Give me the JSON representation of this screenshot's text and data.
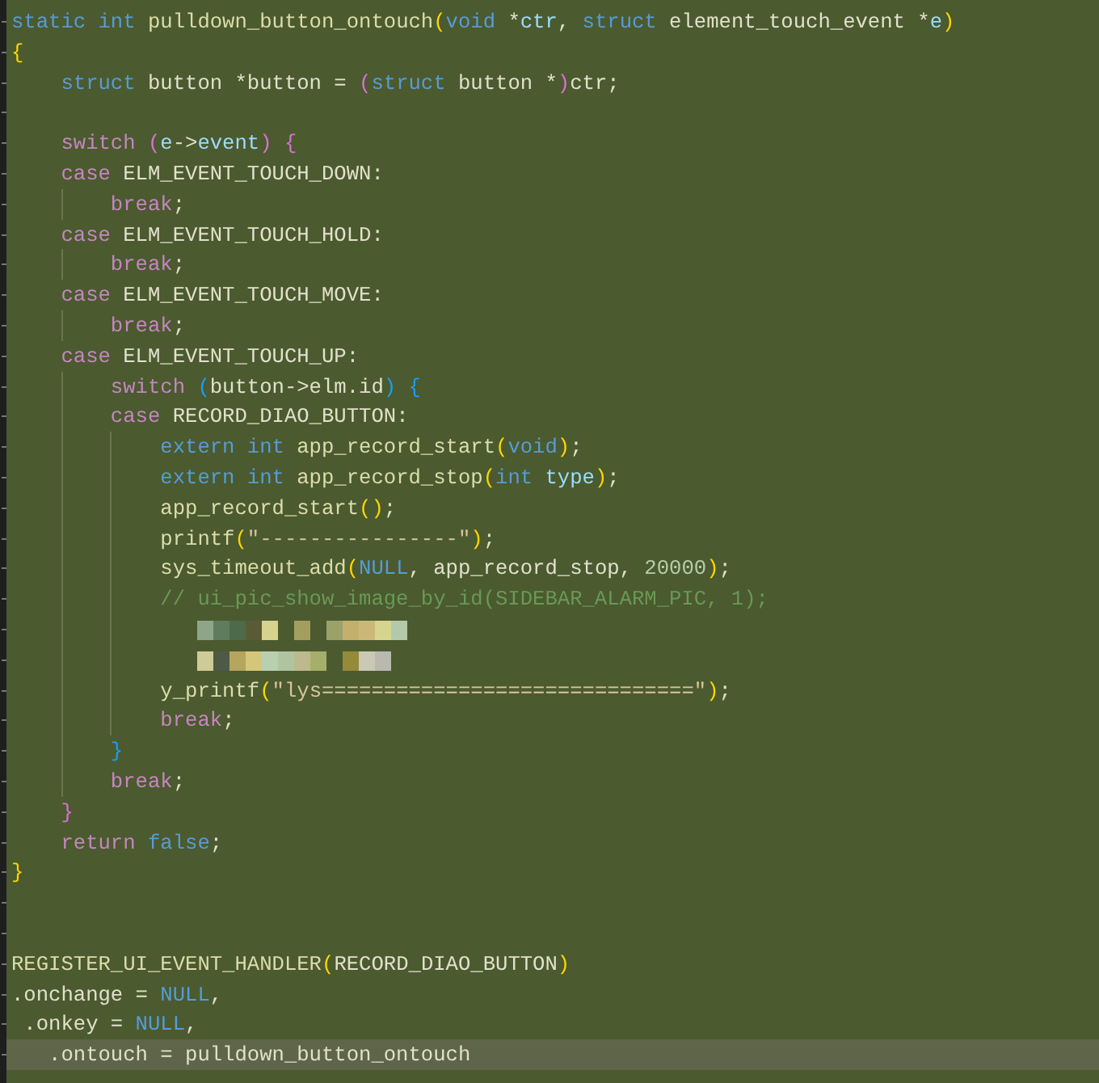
{
  "editor": {
    "lines": [
      {
        "kind": "code",
        "current": false,
        "tokens": [
          {
            "kind": "keyword",
            "text": "static"
          },
          {
            "kind": "keyword",
            "text": " int"
          },
          {
            "kind": "function",
            "text": " pulldown_button_ontouch"
          },
          {
            "kind": "bracket1",
            "text": "("
          },
          {
            "kind": "keyword",
            "text": "void"
          },
          {
            "kind": "plain",
            "text": " *"
          },
          {
            "kind": "variable",
            "text": "ctr"
          },
          {
            "kind": "plain",
            "text": ","
          },
          {
            "kind": "keyword",
            "text": " struct"
          },
          {
            "kind": "plain",
            "text": " element_touch_event *"
          },
          {
            "kind": "variable",
            "text": "e"
          },
          {
            "kind": "bracket1",
            "text": ")"
          }
        ]
      },
      {
        "kind": "code",
        "current": false,
        "tokens": [
          {
            "kind": "bracket1",
            "text": "{"
          }
        ]
      },
      {
        "kind": "code",
        "current": false,
        "tokens": [
          {
            "kind": "keyword",
            "text": "    struct"
          },
          {
            "kind": "plain",
            "text": " button *button ="
          },
          {
            "kind": "bracket2",
            "text": " ("
          },
          {
            "kind": "keyword",
            "text": "struct"
          },
          {
            "kind": "plain",
            "text": " button *"
          },
          {
            "kind": "bracket2",
            "text": ")"
          },
          {
            "kind": "plain",
            "text": "ctr;"
          }
        ]
      },
      {
        "kind": "blank",
        "current": false
      },
      {
        "kind": "code",
        "current": false,
        "tokens": [
          {
            "kind": "control",
            "text": "    switch"
          },
          {
            "kind": "bracket2",
            "text": " ("
          },
          {
            "kind": "variable",
            "text": "e"
          },
          {
            "kind": "plain",
            "text": "->"
          },
          {
            "kind": "variable",
            "text": "event"
          },
          {
            "kind": "bracket2",
            "text": ")"
          },
          {
            "kind": "bracket2",
            "text": " {"
          }
        ]
      },
      {
        "kind": "code",
        "current": false,
        "tokens": [
          {
            "kind": "control",
            "text": "    case"
          },
          {
            "kind": "plain",
            "text": " ELM_EVENT_TOUCH_DOWN:"
          }
        ]
      },
      {
        "kind": "code",
        "current": false,
        "tokens": [
          {
            "kind": "control",
            "text": "        break"
          },
          {
            "kind": "plain",
            "text": ";"
          }
        ]
      },
      {
        "kind": "code",
        "current": false,
        "tokens": [
          {
            "kind": "control",
            "text": "    case"
          },
          {
            "kind": "plain",
            "text": " ELM_EVENT_TOUCH_HOLD:"
          }
        ]
      },
      {
        "kind": "code",
        "current": false,
        "tokens": [
          {
            "kind": "control",
            "text": "        break"
          },
          {
            "kind": "plain",
            "text": ";"
          }
        ]
      },
      {
        "kind": "code",
        "current": false,
        "tokens": [
          {
            "kind": "control",
            "text": "    case"
          },
          {
            "kind": "plain",
            "text": " ELM_EVENT_TOUCH_MOVE:"
          }
        ]
      },
      {
        "kind": "code",
        "current": false,
        "tokens": [
          {
            "kind": "control",
            "text": "        break"
          },
          {
            "kind": "plain",
            "text": ";"
          }
        ]
      },
      {
        "kind": "code",
        "current": false,
        "tokens": [
          {
            "kind": "control",
            "text": "    case"
          },
          {
            "kind": "plain",
            "text": " ELM_EVENT_TOUCH_UP:"
          }
        ]
      },
      {
        "kind": "code",
        "current": false,
        "tokens": [
          {
            "kind": "control",
            "text": "        switch"
          },
          {
            "kind": "bracket3",
            "text": " ("
          },
          {
            "kind": "plain",
            "text": "button->elm.id"
          },
          {
            "kind": "bracket3",
            "text": ")"
          },
          {
            "kind": "bracket3",
            "text": " {"
          }
        ]
      },
      {
        "kind": "code",
        "current": false,
        "tokens": [
          {
            "kind": "control",
            "text": "        case"
          },
          {
            "kind": "plain",
            "text": " RECORD_DIAO_BUTTON:"
          }
        ]
      },
      {
        "kind": "code",
        "current": false,
        "tokens": [
          {
            "kind": "keyword",
            "text": "            extern"
          },
          {
            "kind": "keyword",
            "text": " int"
          },
          {
            "kind": "function",
            "text": " app_record_start"
          },
          {
            "kind": "bracket1",
            "text": "("
          },
          {
            "kind": "keyword",
            "text": "void"
          },
          {
            "kind": "bracket1",
            "text": ")"
          },
          {
            "kind": "plain",
            "text": ";"
          }
        ]
      },
      {
        "kind": "code",
        "current": false,
        "tokens": [
          {
            "kind": "keyword",
            "text": "            extern"
          },
          {
            "kind": "keyword",
            "text": " int"
          },
          {
            "kind": "function",
            "text": " app_record_stop"
          },
          {
            "kind": "bracket1",
            "text": "("
          },
          {
            "kind": "keyword",
            "text": "int"
          },
          {
            "kind": "variable",
            "text": " type"
          },
          {
            "kind": "bracket1",
            "text": ")"
          },
          {
            "kind": "plain",
            "text": ";"
          }
        ]
      },
      {
        "kind": "code",
        "current": false,
        "tokens": [
          {
            "kind": "function",
            "text": "            app_record_start"
          },
          {
            "kind": "bracket1",
            "text": "()"
          },
          {
            "kind": "plain",
            "text": ";"
          }
        ]
      },
      {
        "kind": "code",
        "current": false,
        "tokens": [
          {
            "kind": "function",
            "text": "            printf"
          },
          {
            "kind": "bracket1",
            "text": "("
          },
          {
            "kind": "string",
            "text": "\"----------------\""
          },
          {
            "kind": "bracket1",
            "text": ")"
          },
          {
            "kind": "plain",
            "text": ";"
          }
        ]
      },
      {
        "kind": "code",
        "current": false,
        "tokens": [
          {
            "kind": "function",
            "text": "            sys_timeout_add"
          },
          {
            "kind": "bracket1",
            "text": "("
          },
          {
            "kind": "keyword",
            "text": "NULL"
          },
          {
            "kind": "plain",
            "text": ", app_record_stop,"
          },
          {
            "kind": "number",
            "text": " 20000"
          },
          {
            "kind": "bracket1",
            "text": ")"
          },
          {
            "kind": "plain",
            "text": ";"
          }
        ]
      },
      {
        "kind": "code",
        "current": false,
        "tokens": [
          {
            "kind": "comment",
            "text": "            // ui_pic_show_image_by_id(SIDEBAR_ALARM_PIC, 1);"
          }
        ]
      },
      {
        "kind": "redacted",
        "current": false
      },
      {
        "kind": "redacted",
        "current": false
      },
      {
        "kind": "code",
        "current": false,
        "tokens": [
          {
            "kind": "function",
            "text": "            y_printf"
          },
          {
            "kind": "bracket1",
            "text": "("
          },
          {
            "kind": "string",
            "text": "\"lys==============================\""
          },
          {
            "kind": "bracket1",
            "text": ")"
          },
          {
            "kind": "plain",
            "text": ";"
          }
        ]
      },
      {
        "kind": "code",
        "current": false,
        "tokens": [
          {
            "kind": "control",
            "text": "            break"
          },
          {
            "kind": "plain",
            "text": ";"
          }
        ]
      },
      {
        "kind": "code",
        "current": false,
        "tokens": [
          {
            "kind": "bracket3",
            "text": "        }"
          }
        ]
      },
      {
        "kind": "code",
        "current": false,
        "tokens": [
          {
            "kind": "control",
            "text": "        break"
          },
          {
            "kind": "plain",
            "text": ";"
          }
        ]
      },
      {
        "kind": "code",
        "current": false,
        "tokens": [
          {
            "kind": "bracket2",
            "text": "    }"
          }
        ]
      },
      {
        "kind": "code",
        "current": false,
        "tokens": [
          {
            "kind": "control",
            "text": "    return"
          },
          {
            "kind": "keyword",
            "text": " false"
          },
          {
            "kind": "plain",
            "text": ";"
          }
        ]
      },
      {
        "kind": "code",
        "current": false,
        "tokens": [
          {
            "kind": "bracket1",
            "text": "}"
          }
        ]
      },
      {
        "kind": "blank",
        "current": false
      },
      {
        "kind": "blank",
        "current": false
      },
      {
        "kind": "code",
        "current": false,
        "tokens": [
          {
            "kind": "function",
            "text": "REGISTER_UI_EVENT_HANDLER"
          },
          {
            "kind": "bracket1",
            "text": "("
          },
          {
            "kind": "plain",
            "text": "RECORD_DIAO_BUTTON"
          },
          {
            "kind": "bracket1",
            "text": ")"
          }
        ]
      },
      {
        "kind": "code",
        "current": false,
        "tokens": [
          {
            "kind": "plain",
            "text": ".onchange ="
          },
          {
            "kind": "keyword",
            "text": " NULL"
          },
          {
            "kind": "plain",
            "text": ","
          }
        ]
      },
      {
        "kind": "code",
        "current": false,
        "tokens": [
          {
            "kind": "plain",
            "text": " .onkey ="
          },
          {
            "kind": "keyword",
            "text": " NULL"
          },
          {
            "kind": "plain",
            "text": ","
          }
        ]
      },
      {
        "kind": "code",
        "current": true,
        "tokens": [
          {
            "kind": "plain",
            "text": "   .ontouch = pulldown_button_ontouch"
          }
        ]
      }
    ]
  }
}
